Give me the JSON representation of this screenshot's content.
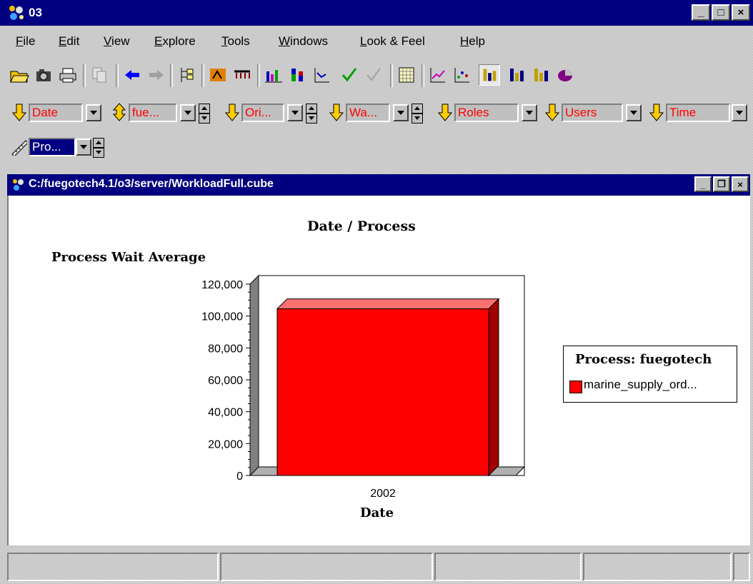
{
  "window": {
    "title": "03",
    "min": "_",
    "max": "□",
    "close": "×"
  },
  "menu": {
    "items": [
      {
        "ul": "F",
        "rest": "ile"
      },
      {
        "ul": "E",
        "rest": "dit"
      },
      {
        "ul": "V",
        "rest": "iew"
      },
      {
        "ul": "E",
        "rest": "xplore"
      },
      {
        "ul": "T",
        "rest": "ools"
      },
      {
        "ul": "W",
        "rest": "indows"
      },
      {
        "ul": "L",
        "rest": "ook & Feel"
      },
      {
        "ul": "H",
        "rest": "elp"
      }
    ]
  },
  "toolbar": {
    "icons": [
      "open-folder-icon",
      "camera-icon",
      "print-icon",
      "copy-icon",
      "back-arrow-icon",
      "forward-arrow-icon",
      "tree-icon",
      "drill-icon",
      "pivot-icon",
      "bar-chart-icon",
      "stacked-bar-icon",
      "scatter-icon",
      "check-icon",
      "uncheck-icon",
      "grid-icon",
      "line-chart-icon",
      "point-chart-icon",
      "3d-bar-icon",
      "3d-stacked-bar-icon",
      "3d-column-icon",
      "pie-chart-icon"
    ]
  },
  "dimensions": {
    "date": "Date",
    "fue": "fue...",
    "ori": "Ori...",
    "wa": "Wa...",
    "roles": "Roles",
    "users": "Users",
    "time": "Time",
    "pro": "Pro..."
  },
  "inner_window": {
    "title": "C:/fuegotech4.1/o3/server/WorkloadFull.cube",
    "min": "_",
    "restore": "❐",
    "close": "×"
  },
  "chart_data": {
    "type": "bar",
    "title": "Date / Process",
    "ylabel": "Process Wait Average",
    "xlabel": "Date",
    "categories": [
      "2002"
    ],
    "series": [
      {
        "name": "marine_supply_ord...",
        "values": [
          104500
        ]
      }
    ],
    "yticks": [
      "120,000",
      "100,000",
      "80,000",
      "60,000",
      "40,000",
      "20,000",
      "0"
    ],
    "ylim": [
      0,
      120000
    ],
    "legend_title": "Process: fuegotech",
    "legend_position": "right",
    "bar_color": "#ff0000"
  }
}
